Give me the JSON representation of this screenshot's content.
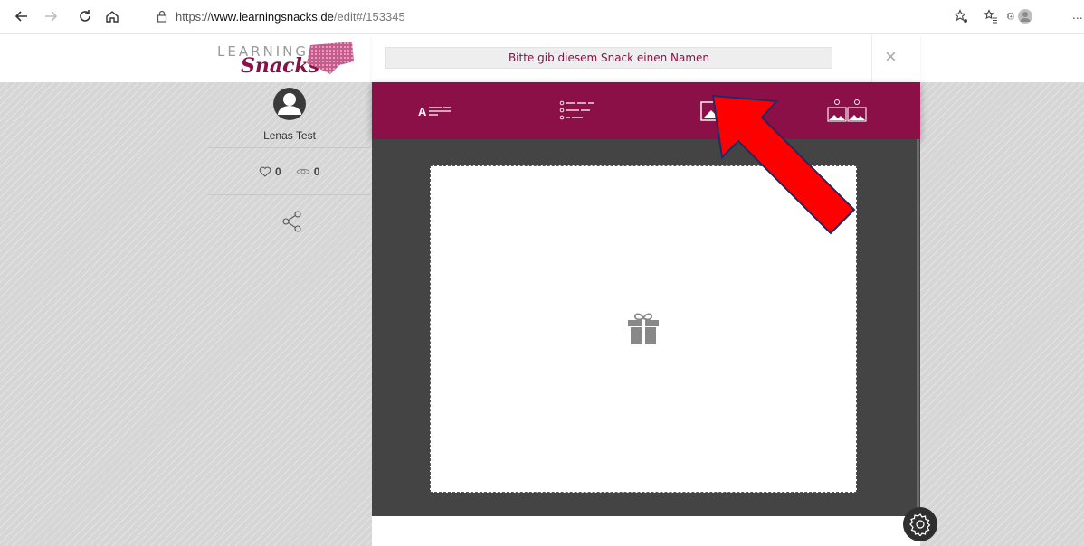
{
  "browser": {
    "url_prefix": "https://",
    "url_domain": "www.learningsnacks.de",
    "url_path": "/edit#/153345",
    "more": "..."
  },
  "logo": {
    "top_text": "LEARNING",
    "script_text": "Snacks"
  },
  "sidebar": {
    "user_name": "Lenas Test",
    "likes": "0",
    "views": "0"
  },
  "editor": {
    "name_placeholder": "Bitte gib diesem Snack einen Namen",
    "close_label": "×",
    "tabs": [
      {
        "icon": "text-block-icon"
      },
      {
        "icon": "quiz-list-icon"
      },
      {
        "icon": "image-icon"
      },
      {
        "icon": "image-choice-icon"
      }
    ],
    "card_icon": "gift-icon"
  },
  "colors": {
    "brand": "#8b1047",
    "canvas": "#444444",
    "annotation_arrow": "#ff0000"
  }
}
